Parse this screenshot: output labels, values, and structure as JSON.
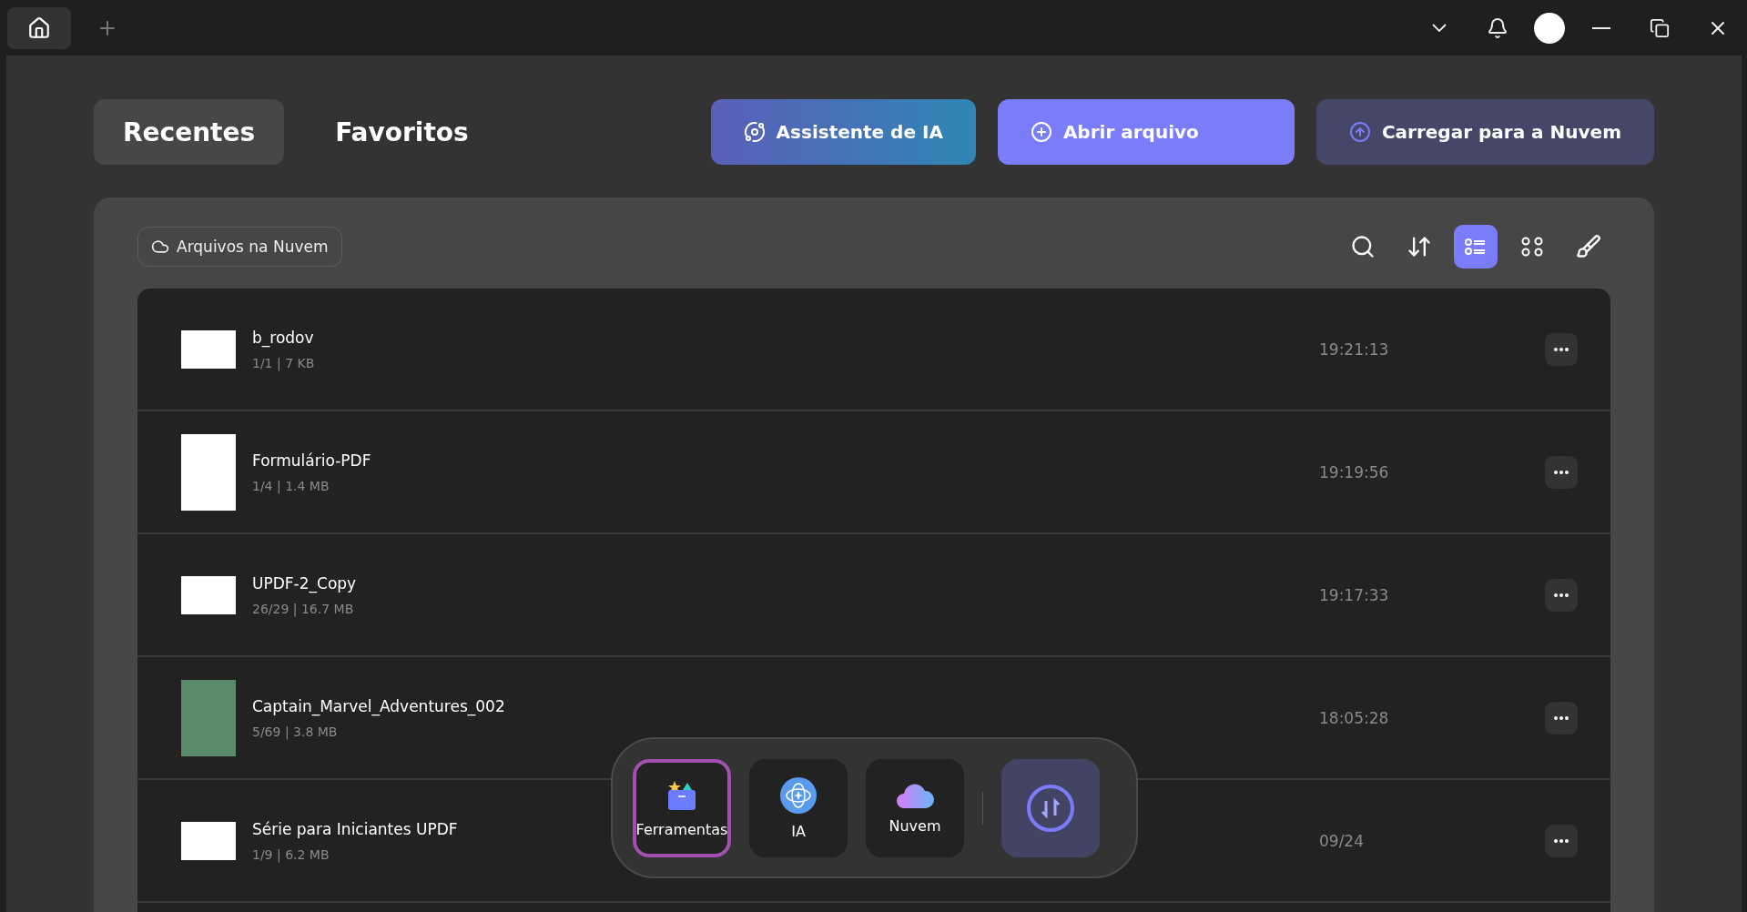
{
  "tabs": [
    {
      "label": "Recentes",
      "selected": true
    },
    {
      "label": "Favoritos",
      "selected": false
    }
  ],
  "actions": [
    {
      "label": "Assistente de IA",
      "kind": "ai"
    },
    {
      "label": "Abrir arquivo",
      "kind": "open"
    },
    {
      "label": "Carregar para a Nuvem",
      "kind": "upload"
    }
  ],
  "cloud_filter": {
    "label": "Arquivos na Nuvem"
  },
  "view_modes": [
    {
      "kind": "list",
      "selected": true
    },
    {
      "kind": "grid",
      "selected": false
    }
  ],
  "files": [
    {
      "name": "b_rodov",
      "meta": "1/1 | 7 KB",
      "time": "19:21:13",
      "kind": "landscape"
    },
    {
      "name": "Formulário-PDF",
      "meta": "1/4 | 1.4 MB",
      "time": "19:19:56",
      "kind": "portrait"
    },
    {
      "name": "UPDF-2_Copy",
      "meta": "26/29 | 16.7 MB",
      "time": "19:17:33",
      "kind": "landscape"
    },
    {
      "name": "Captain_Marvel_Adventures_002",
      "meta": "5/69 | 3.8 MB",
      "time": "18:05:28",
      "kind": "cover"
    },
    {
      "name": "Série para Iniciantes UPDF",
      "meta": "1/9 | 6.2 MB",
      "time": "09/24",
      "kind": "landscape"
    }
  ],
  "dock": [
    {
      "label": "Ferramentas",
      "kind": "tools",
      "selected": true
    },
    {
      "label": "IA",
      "kind": "ai",
      "selected": false
    },
    {
      "label": "Nuvem",
      "kind": "cloud",
      "selected": false
    },
    {
      "kind": "convert",
      "selected": false
    }
  ]
}
